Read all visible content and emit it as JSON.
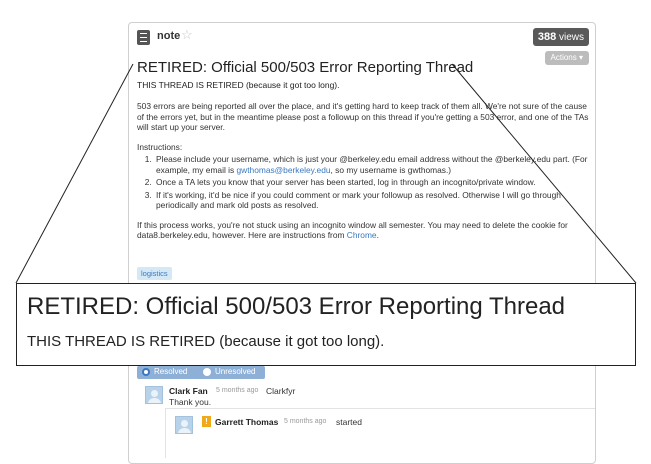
{
  "note": {
    "type_label": "note",
    "views_count": "388",
    "views_label": "views",
    "actions_label": "Actions ▾"
  },
  "post": {
    "title": "RETIRED: Official 500/503 Error Reporting Thread",
    "retired_notice": "THIS THREAD IS RETIRED (because it got too long).",
    "intro": "503 errors are being reported all over the place, and it's getting hard to keep track of them all. We're not sure of the cause of the errors yet, but in the meantime please post a followup on this thread if you're getting a 503 error, and one of the TAs will start up your server.",
    "instructions_heading": "Instructions:",
    "step1_a": "Please include your username, which is just your @berkeley.edu email address without the @berkeley.edu part. (For example, my email is ",
    "step1_link": "gwthomas@berkeley.edu",
    "step1_b": ", so my username is gwthomas.)",
    "step2": "Once a TA lets you know that your server has been started, log in through an incognito/private window.",
    "step3": "If it's working, it'd be nice if you could comment or mark your followup as resolved. Otherwise I will go through periodically and mark old posts as resolved.",
    "closing_a": "If this process works, you're not stuck using an incognito window all semester. You may need to delete the cookie for data8.berkeley.edu, however. Here are instructions from ",
    "closing_link": "Chrome",
    "closing_b": ".",
    "tag": "logistics"
  },
  "followup": {
    "resolved_label": "Resolved",
    "unresolved_label": "Unresolved",
    "author": "Clark Fan",
    "time": "5 months ago",
    "username": "Clarkfyr",
    "text": "Thank you.",
    "reply": {
      "badge": "!",
      "author": "Garrett Thomas",
      "time": "5 months ago",
      "text": "started"
    }
  },
  "zoom": {
    "title": "RETIRED: Official 500/503 Error Reporting Thread",
    "subtitle": "THIS THREAD IS RETIRED (because it got too long)."
  }
}
